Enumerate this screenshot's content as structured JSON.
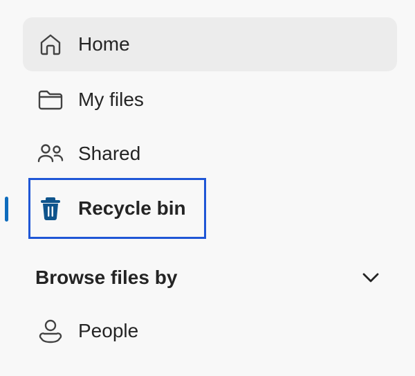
{
  "nav": {
    "items": [
      {
        "label": "Home",
        "icon": "home-icon"
      },
      {
        "label": "My files",
        "icon": "folder-icon"
      },
      {
        "label": "Shared",
        "icon": "people-shared-icon"
      },
      {
        "label": "Recycle bin",
        "icon": "trash-icon",
        "active": true
      }
    ]
  },
  "browse": {
    "title": "Browse files by",
    "items": [
      {
        "label": "People",
        "icon": "person-icon"
      }
    ]
  },
  "colors": {
    "accent": "#0f6cbd",
    "highlight_border": "#1f56d6",
    "hover_background": "#ececec",
    "background": "#f8f8f8",
    "text": "#242424"
  }
}
